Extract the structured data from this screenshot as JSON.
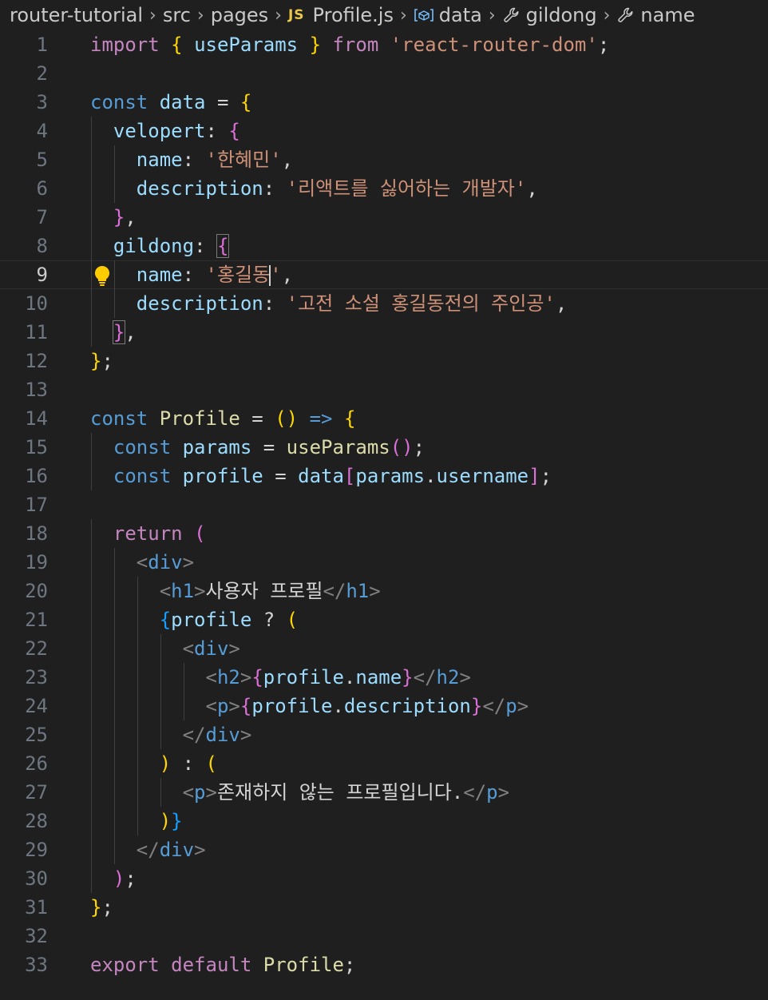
{
  "breadcrumb": {
    "items": [
      "router-tutorial",
      "src",
      "pages",
      "Profile.js",
      "data",
      "gildong",
      "name"
    ],
    "file_type_badge": "JS"
  },
  "editor": {
    "active_line": 9,
    "lines": [
      {
        "n": "1",
        "code": [
          {
            "t": "import",
            "c": "kw"
          },
          {
            "t": " "
          },
          {
            "t": "{",
            "c": "b1"
          },
          {
            "t": " "
          },
          {
            "t": "useParams",
            "c": "va"
          },
          {
            "t": " "
          },
          {
            "t": "}",
            "c": "b1"
          },
          {
            "t": " "
          },
          {
            "t": "from",
            "c": "kw"
          },
          {
            "t": " "
          },
          {
            "t": "'react-router-dom'",
            "c": "str"
          },
          {
            "t": ";",
            "c": "pu"
          }
        ]
      },
      {
        "n": "2",
        "code": []
      },
      {
        "n": "3",
        "code": [
          {
            "t": "const",
            "c": "st"
          },
          {
            "t": " "
          },
          {
            "t": "data",
            "c": "va"
          },
          {
            "t": " = ",
            "c": "pu"
          },
          {
            "t": "{",
            "c": "b1"
          }
        ]
      },
      {
        "n": "4",
        "code": [
          {
            "t": "  "
          },
          {
            "t": "velopert",
            "c": "va"
          },
          {
            "t": ": ",
            "c": "pu"
          },
          {
            "t": "{",
            "c": "b2"
          }
        ]
      },
      {
        "n": "5",
        "code": [
          {
            "t": "    "
          },
          {
            "t": "name",
            "c": "va"
          },
          {
            "t": ": ",
            "c": "pu"
          },
          {
            "t": "'한혜민'",
            "c": "str"
          },
          {
            "t": ",",
            "c": "pu"
          }
        ]
      },
      {
        "n": "6",
        "code": [
          {
            "t": "    "
          },
          {
            "t": "description",
            "c": "va"
          },
          {
            "t": ": ",
            "c": "pu"
          },
          {
            "t": "'리액트를 싫어하는 개발자'",
            "c": "str"
          },
          {
            "t": ",",
            "c": "pu"
          }
        ]
      },
      {
        "n": "7",
        "code": [
          {
            "t": "  "
          },
          {
            "t": "}",
            "c": "b2"
          },
          {
            "t": ",",
            "c": "pu"
          }
        ]
      },
      {
        "n": "8",
        "code": [
          {
            "t": "  "
          },
          {
            "t": "gildong",
            "c": "va"
          },
          {
            "t": ": ",
            "c": "pu"
          },
          {
            "t": "{",
            "c": "b2",
            "bm": true
          }
        ]
      },
      {
        "n": "9",
        "code": [
          {
            "t": "    "
          },
          {
            "t": "name",
            "c": "va"
          },
          {
            "t": ": ",
            "c": "pu"
          },
          {
            "t": "'홍길동",
            "c": "str"
          },
          {
            "caret": true
          },
          {
            "t": "'",
            "c": "str"
          },
          {
            "t": ",",
            "c": "pu"
          }
        ]
      },
      {
        "n": "10",
        "code": [
          {
            "t": "    "
          },
          {
            "t": "description",
            "c": "va"
          },
          {
            "t": ": ",
            "c": "pu"
          },
          {
            "t": "'고전 소설 홍길동전의 주인공'",
            "c": "str"
          },
          {
            "t": ",",
            "c": "pu"
          }
        ]
      },
      {
        "n": "11",
        "code": [
          {
            "t": "  "
          },
          {
            "t": "}",
            "c": "b2",
            "bm": true
          },
          {
            "t": ",",
            "c": "pu"
          }
        ]
      },
      {
        "n": "12",
        "code": [
          {
            "t": "}",
            "c": "b1"
          },
          {
            "t": ";",
            "c": "pu"
          }
        ]
      },
      {
        "n": "13",
        "code": []
      },
      {
        "n": "14",
        "code": [
          {
            "t": "const",
            "c": "st"
          },
          {
            "t": " "
          },
          {
            "t": "Profile",
            "c": "fn"
          },
          {
            "t": " = ",
            "c": "pu"
          },
          {
            "t": "()",
            "c": "b1"
          },
          {
            "t": " "
          },
          {
            "t": "=>",
            "c": "st"
          },
          {
            "t": " "
          },
          {
            "t": "{",
            "c": "b1"
          }
        ]
      },
      {
        "n": "15",
        "code": [
          {
            "t": "  "
          },
          {
            "t": "const",
            "c": "st"
          },
          {
            "t": " "
          },
          {
            "t": "params",
            "c": "va"
          },
          {
            "t": " = ",
            "c": "pu"
          },
          {
            "t": "useParams",
            "c": "fn"
          },
          {
            "t": "()",
            "c": "b2"
          },
          {
            "t": ";",
            "c": "pu"
          }
        ]
      },
      {
        "n": "16",
        "code": [
          {
            "t": "  "
          },
          {
            "t": "const",
            "c": "st"
          },
          {
            "t": " "
          },
          {
            "t": "profile",
            "c": "va"
          },
          {
            "t": " = ",
            "c": "pu"
          },
          {
            "t": "data",
            "c": "va"
          },
          {
            "t": "[",
            "c": "b2"
          },
          {
            "t": "params",
            "c": "va"
          },
          {
            "t": ".",
            "c": "pu"
          },
          {
            "t": "username",
            "c": "va"
          },
          {
            "t": "]",
            "c": "b2"
          },
          {
            "t": ";",
            "c": "pu"
          }
        ]
      },
      {
        "n": "17",
        "code": []
      },
      {
        "n": "18",
        "code": [
          {
            "t": "  "
          },
          {
            "t": "return",
            "c": "kw"
          },
          {
            "t": " "
          },
          {
            "t": "(",
            "c": "b2"
          }
        ]
      },
      {
        "n": "19",
        "code": [
          {
            "t": "    "
          },
          {
            "t": "<",
            "c": "tb"
          },
          {
            "t": "div",
            "c": "tag"
          },
          {
            "t": ">",
            "c": "tb"
          }
        ]
      },
      {
        "n": "20",
        "code": [
          {
            "t": "      "
          },
          {
            "t": "<",
            "c": "tb"
          },
          {
            "t": "h1",
            "c": "tag"
          },
          {
            "t": ">",
            "c": "tb"
          },
          {
            "t": "사용자 프로필",
            "c": "tx"
          },
          {
            "t": "</",
            "c": "tb"
          },
          {
            "t": "h1",
            "c": "tag"
          },
          {
            "t": ">",
            "c": "tb"
          }
        ]
      },
      {
        "n": "21",
        "code": [
          {
            "t": "      "
          },
          {
            "t": "{",
            "c": "b3"
          },
          {
            "t": "profile",
            "c": "va"
          },
          {
            "t": " ? ",
            "c": "pu"
          },
          {
            "t": "(",
            "c": "b1"
          }
        ]
      },
      {
        "n": "22",
        "code": [
          {
            "t": "        "
          },
          {
            "t": "<",
            "c": "tb"
          },
          {
            "t": "div",
            "c": "tag"
          },
          {
            "t": ">",
            "c": "tb"
          }
        ]
      },
      {
        "n": "23",
        "code": [
          {
            "t": "          "
          },
          {
            "t": "<",
            "c": "tb"
          },
          {
            "t": "h2",
            "c": "tag"
          },
          {
            "t": ">",
            "c": "tb"
          },
          {
            "t": "{",
            "c": "b2"
          },
          {
            "t": "profile",
            "c": "va"
          },
          {
            "t": ".",
            "c": "pu"
          },
          {
            "t": "name",
            "c": "va"
          },
          {
            "t": "}",
            "c": "b2"
          },
          {
            "t": "</",
            "c": "tb"
          },
          {
            "t": "h2",
            "c": "tag"
          },
          {
            "t": ">",
            "c": "tb"
          }
        ]
      },
      {
        "n": "24",
        "code": [
          {
            "t": "          "
          },
          {
            "t": "<",
            "c": "tb"
          },
          {
            "t": "p",
            "c": "tag"
          },
          {
            "t": ">",
            "c": "tb"
          },
          {
            "t": "{",
            "c": "b2"
          },
          {
            "t": "profile",
            "c": "va"
          },
          {
            "t": ".",
            "c": "pu"
          },
          {
            "t": "description",
            "c": "va"
          },
          {
            "t": "}",
            "c": "b2"
          },
          {
            "t": "</",
            "c": "tb"
          },
          {
            "t": "p",
            "c": "tag"
          },
          {
            "t": ">",
            "c": "tb"
          }
        ]
      },
      {
        "n": "25",
        "code": [
          {
            "t": "        "
          },
          {
            "t": "</",
            "c": "tb"
          },
          {
            "t": "div",
            "c": "tag"
          },
          {
            "t": ">",
            "c": "tb"
          }
        ]
      },
      {
        "n": "26",
        "code": [
          {
            "t": "      "
          },
          {
            "t": ")",
            "c": "b1"
          },
          {
            "t": " : ",
            "c": "pu"
          },
          {
            "t": "(",
            "c": "b1"
          }
        ]
      },
      {
        "n": "27",
        "code": [
          {
            "t": "        "
          },
          {
            "t": "<",
            "c": "tb"
          },
          {
            "t": "p",
            "c": "tag"
          },
          {
            "t": ">",
            "c": "tb"
          },
          {
            "t": "존재하지 않는 프로필입니다.",
            "c": "tx"
          },
          {
            "t": "</",
            "c": "tb"
          },
          {
            "t": "p",
            "c": "tag"
          },
          {
            "t": ">",
            "c": "tb"
          }
        ]
      },
      {
        "n": "28",
        "code": [
          {
            "t": "      "
          },
          {
            "t": ")",
            "c": "b1"
          },
          {
            "t": "}",
            "c": "b3"
          }
        ]
      },
      {
        "n": "29",
        "code": [
          {
            "t": "    "
          },
          {
            "t": "</",
            "c": "tb"
          },
          {
            "t": "div",
            "c": "tag"
          },
          {
            "t": ">",
            "c": "tb"
          }
        ]
      },
      {
        "n": "30",
        "code": [
          {
            "t": "  "
          },
          {
            "t": ")",
            "c": "b2"
          },
          {
            "t": ";",
            "c": "pu"
          }
        ]
      },
      {
        "n": "31",
        "code": [
          {
            "t": "}",
            "c": "b1"
          },
          {
            "t": ";",
            "c": "pu"
          }
        ]
      },
      {
        "n": "32",
        "code": []
      },
      {
        "n": "33",
        "code": [
          {
            "t": "export",
            "c": "kw"
          },
          {
            "t": " "
          },
          {
            "t": "default",
            "c": "kw"
          },
          {
            "t": " "
          },
          {
            "t": "Profile",
            "c": "fn"
          },
          {
            "t": ";",
            "c": "pu"
          }
        ]
      }
    ]
  }
}
